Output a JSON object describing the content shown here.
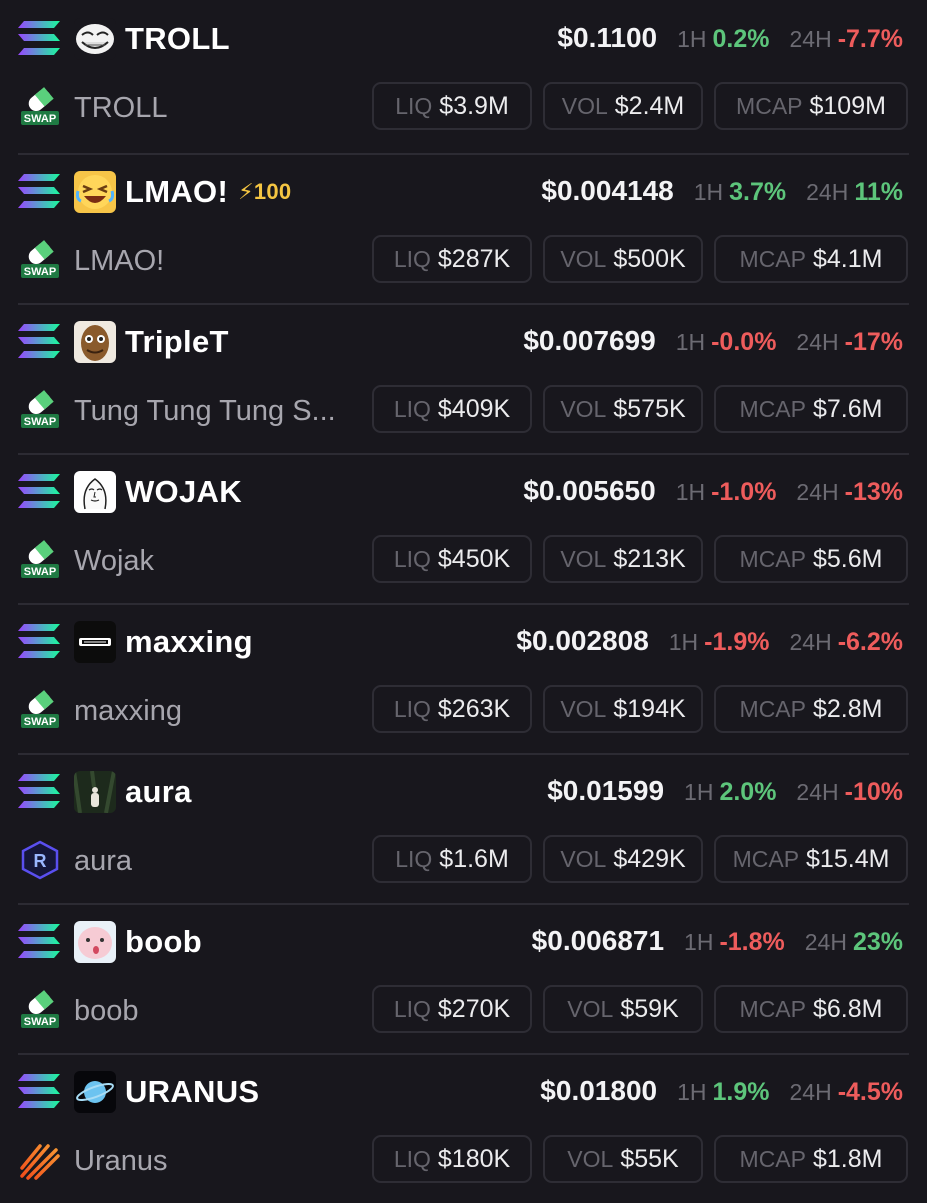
{
  "colors": {
    "background": "#18171d",
    "positive": "#5dc57b",
    "negative": "#ee5c5c",
    "boost": "#f4c542",
    "muted_text": "#a7a6ae",
    "label_text": "#6c6b73"
  },
  "labels": {
    "h1": "1H",
    "h24": "24H",
    "liq": "LIQ",
    "vol": "VOL",
    "mcap": "MCAP",
    "swap_badge": "SWAP"
  },
  "tokens": [
    {
      "symbol": "TROLL",
      "name": "TROLL",
      "boost": "",
      "avatar": "trollface-icon",
      "chain_icon": "solana-icon",
      "dex_icon": "pumpswap-icon",
      "price": "$0.1100",
      "change_1h": "0.2%",
      "change_1h_dir": "pos",
      "change_24h": "-7.7%",
      "change_24h_dir": "neg",
      "liq": "$3.9M",
      "vol": "$2.4M",
      "mcap": "$109M"
    },
    {
      "symbol": "LMAO!",
      "name": "LMAO!",
      "boost": "⚡100",
      "avatar": "laughing-emoji-icon",
      "chain_icon": "solana-icon",
      "dex_icon": "pumpswap-icon",
      "price": "$0.004148",
      "change_1h": "3.7%",
      "change_1h_dir": "pos",
      "change_24h": "11%",
      "change_24h_dir": "pos",
      "liq": "$287K",
      "vol": "$500K",
      "mcap": "$4.1M"
    },
    {
      "symbol": "TripleT",
      "name": "Tung Tung Tung S...",
      "boost": "",
      "avatar": "wooden-figure-icon",
      "chain_icon": "solana-icon",
      "dex_icon": "pumpswap-icon",
      "price": "$0.007699",
      "change_1h": "-0.0%",
      "change_1h_dir": "neg",
      "change_24h": "-17%",
      "change_24h_dir": "neg",
      "liq": "$409K",
      "vol": "$575K",
      "mcap": "$7.6M"
    },
    {
      "symbol": "WOJAK",
      "name": "Wojak",
      "boost": "",
      "avatar": "wojak-face-icon",
      "chain_icon": "solana-icon",
      "dex_icon": "pumpswap-icon",
      "price": "$0.005650",
      "change_1h": "-1.0%",
      "change_1h_dir": "neg",
      "change_24h": "-13%",
      "change_24h_dir": "neg",
      "liq": "$450K",
      "vol": "$213K",
      "mcap": "$5.6M"
    },
    {
      "symbol": "maxxing",
      "name": "maxxing",
      "boost": "",
      "avatar": "maxxing-logo-icon",
      "chain_icon": "solana-icon",
      "dex_icon": "pumpswap-icon",
      "price": "$0.002808",
      "change_1h": "-1.9%",
      "change_1h_dir": "neg",
      "change_24h": "-6.2%",
      "change_24h_dir": "neg",
      "liq": "$263K",
      "vol": "$194K",
      "mcap": "$2.8M"
    },
    {
      "symbol": "aura",
      "name": "aura",
      "boost": "",
      "avatar": "forest-figure-icon",
      "chain_icon": "solana-icon",
      "dex_icon": "raydium-icon",
      "price": "$0.01599",
      "change_1h": "2.0%",
      "change_1h_dir": "pos",
      "change_24h": "-10%",
      "change_24h_dir": "neg",
      "liq": "$1.6M",
      "vol": "$429K",
      "mcap": "$15.4M"
    },
    {
      "symbol": "boob",
      "name": "boob",
      "boost": "",
      "avatar": "pink-face-icon",
      "chain_icon": "solana-icon",
      "dex_icon": "pumpswap-icon",
      "price": "$0.006871",
      "change_1h": "-1.8%",
      "change_1h_dir": "neg",
      "change_24h": "23%",
      "change_24h_dir": "pos",
      "liq": "$270K",
      "vol": "$59K",
      "mcap": "$6.8M"
    },
    {
      "symbol": "URANUS",
      "name": "Uranus",
      "boost": "",
      "avatar": "planet-icon",
      "chain_icon": "solana-icon",
      "dex_icon": "meteora-icon",
      "price": "$0.01800",
      "change_1h": "1.9%",
      "change_1h_dir": "pos",
      "change_24h": "-4.5%",
      "change_24h_dir": "neg",
      "liq": "$180K",
      "vol": "$55K",
      "mcap": "$1.8M"
    }
  ]
}
